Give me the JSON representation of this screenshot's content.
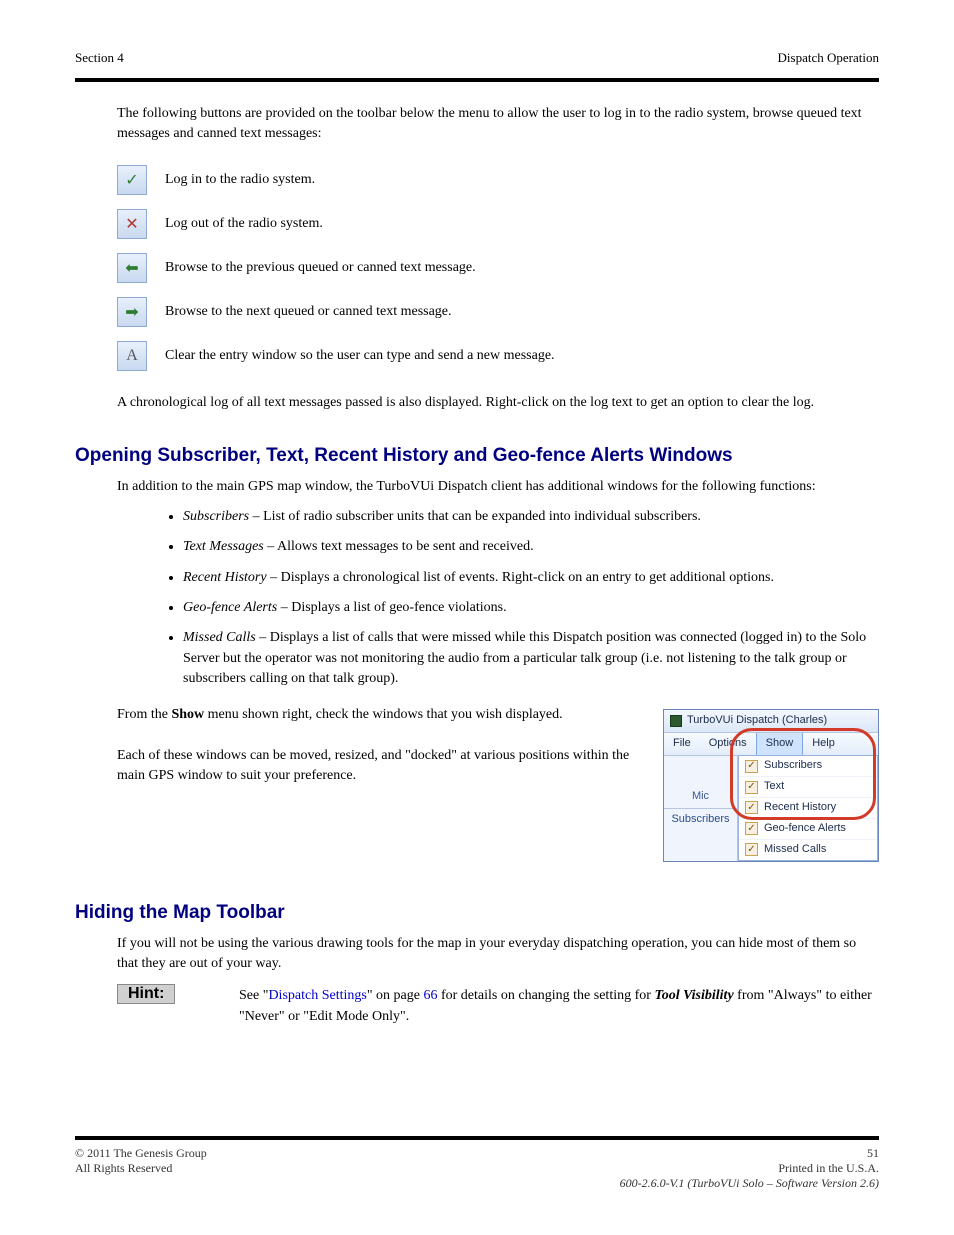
{
  "header": {
    "left": "Section 4",
    "right": "Dispatch Operation"
  },
  "intro": {
    "p1": "The following buttons are provided on the toolbar below the menu to allow the user to log in to the radio system, browse queued text messages and canned text messages:"
  },
  "toolbar_icons": [
    {
      "name": "log-in-icon",
      "glyph": "✓",
      "desc": "Log in to the radio system."
    },
    {
      "name": "log-out-icon",
      "glyph": "✕",
      "desc": "Log out of the radio system."
    },
    {
      "name": "prev-icon",
      "glyph": "⬅",
      "desc": "Browse to the previous queued or canned text message."
    },
    {
      "name": "next-icon",
      "glyph": "➡",
      "desc": "Browse to the next queued or canned text message."
    },
    {
      "name": "clear-icon",
      "glyph": "A",
      "desc": "Clear the entry window so the user can type and send a new message."
    }
  ],
  "log_note": "A chronological log of all text messages passed is also displayed. Right-click on the log text to get an option to clear the log.",
  "extra_windows_title": "Opening Subscriber, Text, Recent History and Geo-fence Alerts Windows",
  "extra_windows_intro": "In addition to the main GPS map window, the TurboVUi Dispatch client has additional windows for the following functions:",
  "window_items": [
    {
      "label": "Subscribers",
      "desc": " – List of radio subscriber units that can be expanded into individual subscribers."
    },
    {
      "label": "Text Messages",
      "desc": " – Allows text messages to be sent and received."
    },
    {
      "label": "Recent History",
      "desc": " – Displays a chronological list of events. Right-click on an entry to get additional options."
    },
    {
      "label": "Geo-fence Alerts",
      "desc": " – Displays a list of geo-fence violations."
    },
    {
      "label": "Missed Calls",
      "desc": " – Displays a list of calls that were missed while this Dispatch position was connected (logged in) to the Solo Server but the operator was not monitoring the audio from a particular talk group (i.e. not listening to the talk group or subscribers calling on that talk group)."
    }
  ],
  "show_text": {
    "p1_a": "From the ",
    "p1_b": "Show",
    "p1_c": " menu shown right, check the windows that you wish displayed.",
    "p2": "Each of these windows can be moved, resized, and \"docked\" at various positions within the main GPS window to suit your preference."
  },
  "screenshot": {
    "title": "TurboVUi Dispatch  (Charles)",
    "menus": [
      "File",
      "Options",
      "Show",
      "Help"
    ],
    "mic_label": "Mic",
    "subscribers_label": "Subscribers",
    "dropdown": [
      "Subscribers",
      "Text",
      "Recent History",
      "Geo-fence Alerts",
      "Missed Calls"
    ]
  },
  "hiding_title": "Hiding the Map Toolbar",
  "hiding_p": "If you will not be using the various drawing tools for the map in your everyday dispatching operation, you can hide most of them so that they are out of your way.",
  "hint": {
    "label": "Hint:",
    "before_link": "See \"",
    "link": "Dispatch Settings",
    "after_link": "\" on page ",
    "page": "66",
    "rest": " for details on changing the setting for ",
    "ital": "Tool Visibility",
    "tail": " from \"Always\" to either \"Never\" or \"Edit Mode Only\"."
  },
  "footer": {
    "copyright": "© 2011 The Genesis Group",
    "page": "51",
    "rights": "All Rights Reserved",
    "printed": "Printed in the U.S.A.",
    "doc": "600-2.6.0-V.1 (TurboVUi Solo – Software Version 2.6)"
  }
}
